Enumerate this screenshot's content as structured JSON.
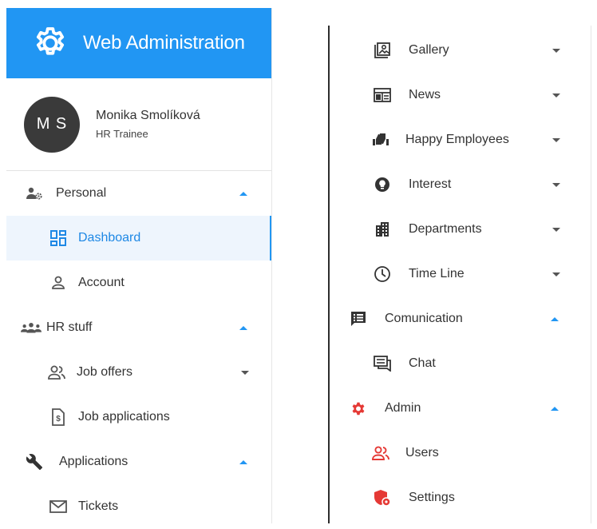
{
  "brand": {
    "title": "Web Administration",
    "color": "#2196f3"
  },
  "user": {
    "initials": "M S",
    "name": "Monika Smolíková",
    "role": "HR Trainee"
  },
  "left_nav": {
    "personal": "Personal",
    "dashboard": "Dashboard",
    "account": "Account",
    "hr_stuff": "HR stuff",
    "job_offers": "Job offers",
    "job_applications": "Job applications",
    "applications": "Applications",
    "tickets": "Tickets"
  },
  "right_nav": {
    "gallery": "Gallery",
    "news": "News",
    "happy_employees": "Happy Employees",
    "interest": "Interest",
    "departments": "Departments",
    "time_line": "Time Line",
    "comunication": "Comunication",
    "chat": "Chat",
    "admin": "Admin",
    "users": "Users",
    "settings": "Settings"
  },
  "colors": {
    "accent": "#2196f3",
    "active_bg": "#eef5fd",
    "admin_red": "#e53935"
  },
  "icons": [
    "gear-icon",
    "people-gear-icon",
    "dashboard-icon",
    "account-icon",
    "group-icon",
    "job-offers-icon",
    "document-dollar-icon",
    "wrench-icon",
    "mail-icon",
    "gallery-icon",
    "news-icon",
    "thumbs-icon",
    "lightbulb-icon",
    "building-icon",
    "clock-icon",
    "message-icon",
    "chat-icon",
    "admin-gear-icon",
    "users-icon",
    "shield-icon"
  ]
}
